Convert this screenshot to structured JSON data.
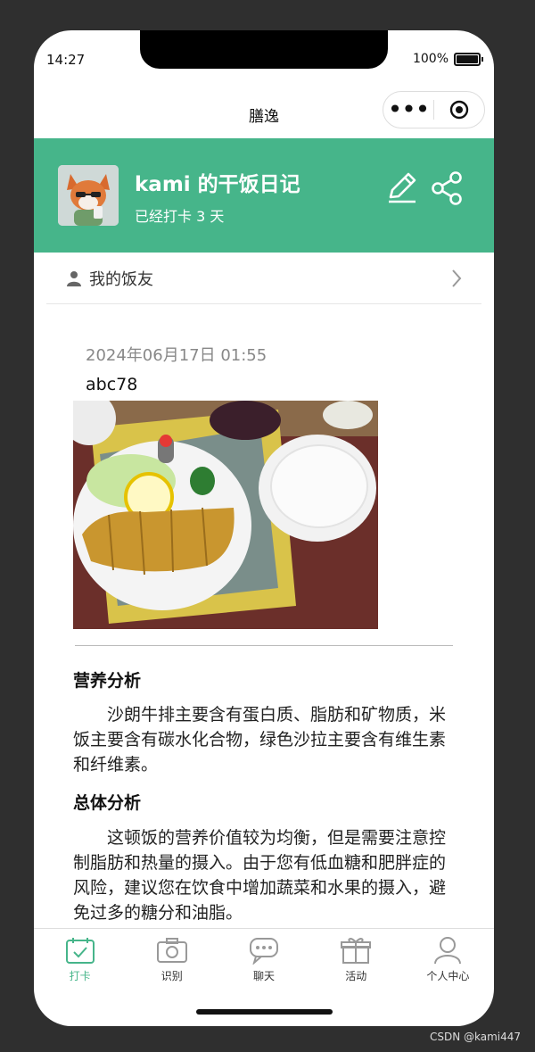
{
  "status": {
    "time": "14:27",
    "battery": "100%"
  },
  "nav": {
    "title": "膳逸"
  },
  "header": {
    "title": "kami 的干饭日记",
    "subtitle": "已经打卡 3 天"
  },
  "friends": {
    "label": "我的饭友"
  },
  "entry": {
    "date": "2024年06月17日 01:55",
    "text": "abc78",
    "nutrition_title": "营养分析",
    "nutrition_text": "沙朗牛排主要含有蛋白质、脂肪和矿物质，米饭主要含有碳水化合物，绿色沙拉主要含有维生素和纤维素。",
    "overall_title": "总体分析",
    "overall_text": "这顿饭的营养价值较为均衡，但是需要注意控制脂肪和热量的摄入。由于您有低血糖和肥胖症的风险，建议您在饮食中增加蔬菜和水果的摄入，避免过多的糖分和油脂。"
  },
  "tabs": [
    {
      "label": "打卡",
      "icon": "calendar-check-icon",
      "active": true
    },
    {
      "label": "识别",
      "icon": "camera-icon"
    },
    {
      "label": "聊天",
      "icon": "chat-icon"
    },
    {
      "label": "活动",
      "icon": "gift-icon"
    },
    {
      "label": "个人中心",
      "icon": "user-icon"
    }
  ],
  "colors": {
    "accent": "#46b58a"
  },
  "watermark": "CSDN @kami447"
}
